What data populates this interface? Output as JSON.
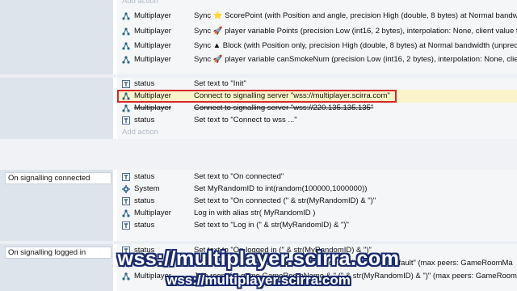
{
  "top_block": {
    "add_action": "Add action",
    "rows": [
      {
        "object": "Multiplayer",
        "icon": "multiplayer-icon",
        "action": "Sync ⭐ ScorePoint (with Position and angle, precision High (double, 8 bytes) at Normal bandwidth"
      },
      {
        "object": "Multiplayer",
        "icon": "multiplayer-icon",
        "action": "Sync 🚀 player variable Points (precision Low (int16, 2 bytes), interpolation: None, client value tag"
      },
      {
        "object": "Multiplayer",
        "icon": "multiplayer-icon",
        "action": "Sync ▲ Block (with Position only, precision High (double, 8 bytes) at Normal bandwidth (unpred"
      },
      {
        "object": "Multiplayer",
        "icon": "multiplayer-icon",
        "action": "Sync 🚀 player variable canSmokeNum (precision Low (int16, 2 bytes), interpolation: None, client"
      }
    ]
  },
  "mid_block": {
    "rows": [
      {
        "object": "status",
        "icon": "text-icon",
        "action": "Set text to \"Init\""
      },
      {
        "object": "Multiplayer",
        "icon": "multiplayer-icon",
        "action": "Connect to signalling server \"wss://multiplayer.scirra.com\"",
        "highlighted": true
      },
      {
        "object": "Multiplayer",
        "icon": "multiplayer-icon",
        "action": "Connect to signalling server \"wss://220.135.135.135\"",
        "disabled": true
      },
      {
        "object": "status",
        "icon": "text-icon",
        "action": "Set text to \"Connect to wss ...\""
      }
    ],
    "add_action": "Add action"
  },
  "signalling_connected": {
    "condition": "On signalling connected",
    "rows": [
      {
        "object": "status",
        "icon": "text-icon",
        "action": "Set text to \"On connected\""
      },
      {
        "object": "System",
        "icon": "gear-icon",
        "action": "Set MyRandomID to int(random(100000,1000000))"
      },
      {
        "object": "status",
        "icon": "text-icon",
        "action": "Set text to \"On connected (\" & str(MyRandomID) & \")\""
      },
      {
        "object": "Multiplayer",
        "icon": "multiplayer-icon",
        "action": "Log in with alias str( MyRandomID )"
      },
      {
        "object": "status",
        "icon": "text-icon",
        "action": "Set text to \"Log in (\" & str(MyRandomID) & \")\""
      }
    ]
  },
  "signalling_logged_in": {
    "condition": "On signalling logged in",
    "rows": [
      {
        "object": "status",
        "icon": "text-icon",
        "action": "Set text to \"On logged in (\" & str(MyRandomID) & \")\""
      },
      {
        "object": "Multiplayer",
        "icon": "multiplayer-icon",
        "action": "Join room GameRoomName for game \"default\" instance \"default\" (max peers: GameRoomMa"
      },
      {
        "object": "Multiplayer",
        "icon": "multiplayer-icon",
        "action": "Join room for game GameRoomName & \" (\" & str(MyRandomID) & \")\" (max peers: GameRoomMa"
      }
    ]
  },
  "subtitles": {
    "line1": "wss://multiplayer.scirra.com",
    "line2": "wss://multiplayer.scirra.com"
  },
  "colors": {
    "highlight_border": "#d8282b",
    "condition_bg": "#dde4ec",
    "action_bg": "#f4f6f8",
    "subtitle_outline": "#1a2a6b"
  }
}
